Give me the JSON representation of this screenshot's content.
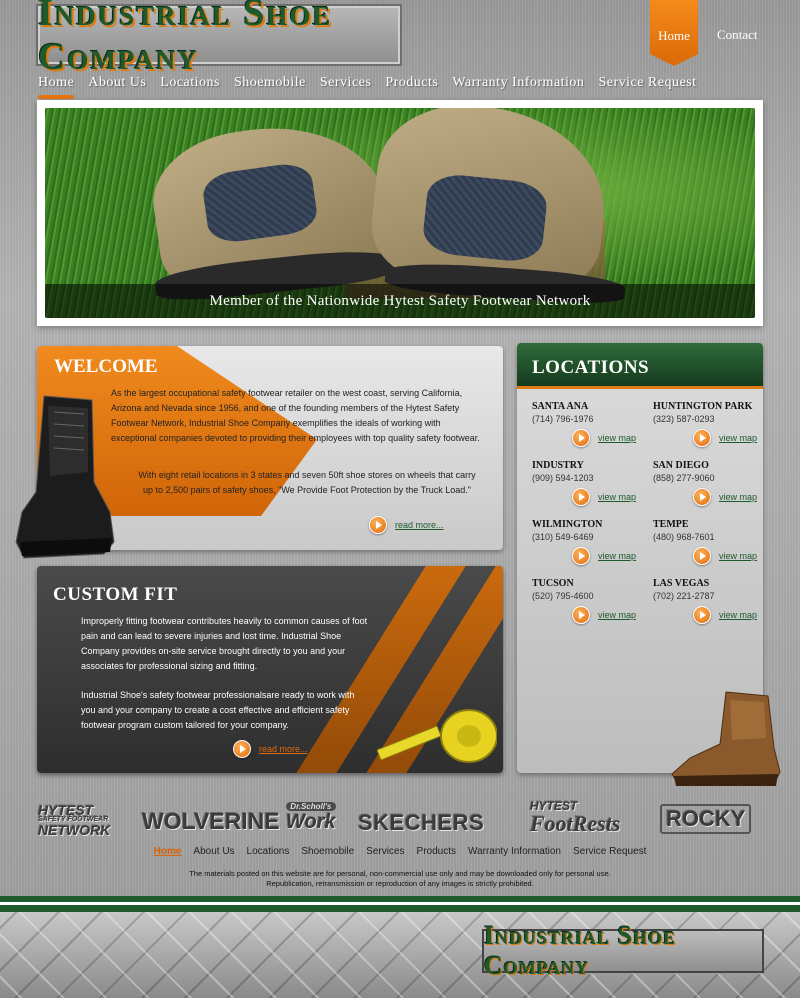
{
  "header": {
    "logo_text": "Industrial Shoe Company",
    "top_links": {
      "home": "Home",
      "contact": "Contact"
    }
  },
  "nav": [
    "Home",
    "About Us",
    "Locations",
    "Shoemobile",
    "Services",
    "Products",
    "Warranty Information",
    "Service Request"
  ],
  "hero": {
    "caption": "Member of the Nationwide Hytest Safety Footwear Network"
  },
  "welcome": {
    "title": "WELCOME",
    "p1": "As the largest occupational safety footwear retailer on the west coast, serving California, Arizona and Nevada since 1956, and one of the founding members of the Hytest Safety Footwear Network, Industrial Shoe Company exemplifies the ideals of working with exceptional companies devoted to providing their employees with top quality safety footwear.",
    "p2": "With eight retail locations in 3 states and seven 50ft shoe stores on wheels that carry up to 2,500 pairs of safety shoes, \"We Provide Foot Protection by the Truck Load.\"",
    "read_more": "read more..."
  },
  "custom_fit": {
    "title": "CUSTOM FIT",
    "p1": "Improperly fitting footwear contributes heavily to common causes of foot pain and can lead to severe injuries and lost time.  Industrial Shoe Company provides on-site service brought directly to you and your associates for professional sizing and fitting.",
    "p2": "Industrial Shoe's safety footwear professionalsare ready to work with you and your company to create a cost effective and efficient safety footwear program custom tailored for your company.",
    "read_more": "read more..."
  },
  "locations": {
    "title": "LOCATIONS",
    "view_map": "view map",
    "items": [
      {
        "name": "SANTA ANA",
        "phone": "(714) 796-1976"
      },
      {
        "name": "HUNTINGTON PARK",
        "phone": "(323) 587-0293"
      },
      {
        "name": "INDUSTRY",
        "phone": "(909) 594-1203"
      },
      {
        "name": "SAN DIEGO",
        "phone": "(858) 277-9060"
      },
      {
        "name": "WILMINGTON",
        "phone": "(310) 549-6469"
      },
      {
        "name": "TEMPE",
        "phone": "(480) 968-7601"
      },
      {
        "name": "TUCSON",
        "phone": "(520) 795-4600"
      },
      {
        "name": "LAS VEGAS",
        "phone": "(702) 221-2787"
      }
    ]
  },
  "brands": {
    "hytest_1": "HYTEST",
    "hytest_2": "SAFETY FOOTWEAR",
    "hytest_3": "NETWORK",
    "wolverine": "WOLVERINE",
    "scholls_1": "Dr.Scholl's",
    "scholls_2": "Work",
    "skechers": "SKECHERS",
    "footrests_1": "HYTEST",
    "footrests_2": "FootRests",
    "rocky": "ROCKY"
  },
  "footer_nav": [
    "Home",
    "About Us",
    "Locations",
    "Shoemobile",
    "Services",
    "Products",
    "Warranty Information",
    "Service Request"
  ],
  "disclaimer": {
    "line1": "The materials posted on this website are for personal, non-commercial use only and may be downloaded only for personal use.",
    "line2": "Republication, retransmission or reproduction of any images is strictly prohibited."
  },
  "footer_logo": "Industrial Shoe Company",
  "colors": {
    "accent": "#e8750e",
    "brand_green": "#1f5a2c"
  }
}
